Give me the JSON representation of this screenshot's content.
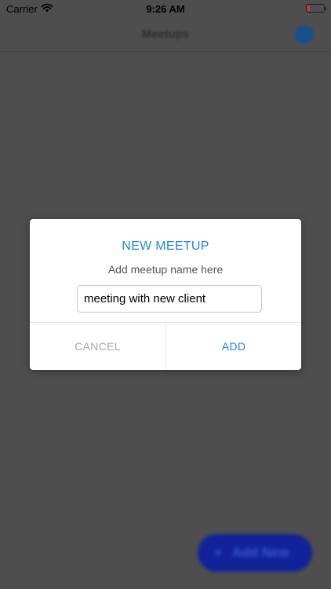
{
  "status_bar": {
    "carrier": "Carrier",
    "time": "9:26 AM",
    "wifi_icon": "wifi-icon",
    "battery_icon": "battery-low-icon",
    "battery_color": "#e33333",
    "battery_level": 0.15
  },
  "nav": {
    "title": "Meetups",
    "avatar_color": "#1b4f8c"
  },
  "fab": {
    "icon": "plus-icon",
    "label": "Add New",
    "color": "#12239a"
  },
  "dialog": {
    "title": "NEW MEETUP",
    "message": "Add meetup name here",
    "input_value": "meeting with new client",
    "cancel_label": "CANCEL",
    "add_label": "ADD",
    "accent_color": "#1e88e5"
  },
  "overlay_color": "#4e4e4e"
}
